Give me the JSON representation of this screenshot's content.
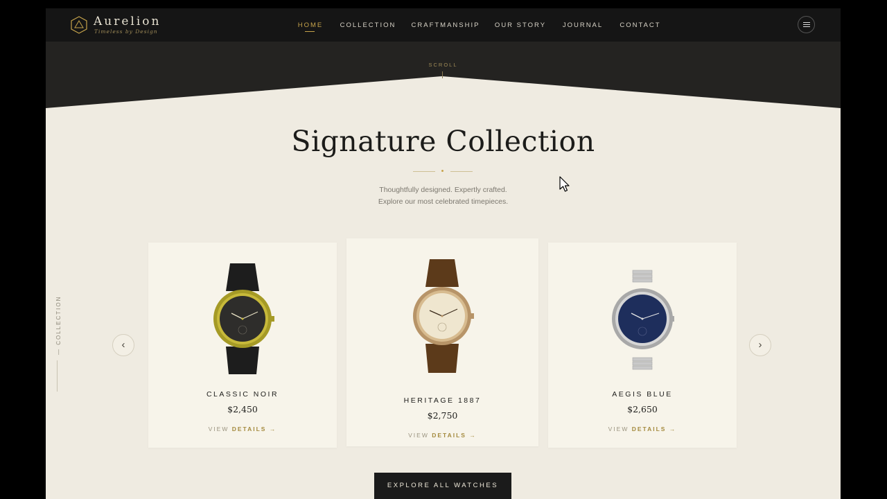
{
  "brand": {
    "name": "Aurelion",
    "tagline": "Timeless by Design"
  },
  "nav": {
    "items": [
      "HOME",
      "COLLECTION",
      "CRAFTMANSHIP",
      "OUR STORY",
      "JOURNAL",
      "CONTACT"
    ],
    "active": "HOME"
  },
  "hero": {
    "scroll_label": "SCROLL"
  },
  "section": {
    "title": "Signature Collection",
    "subtitle_line1": "Thoughtfully designed. Expertly crafted.",
    "subtitle_line2": "Explore our most celebrated timepieces.",
    "side_label": "— COLLECTION"
  },
  "carousel": {
    "prev": "‹",
    "next": "›",
    "products": [
      {
        "name": "CLASSIC NOIR",
        "price": "$2,450",
        "link_prefix": "VIEW",
        "link_emphasis": "DETAILS",
        "link_arrow": "→"
      },
      {
        "name": "HERITAGE 1887",
        "price": "$2,750",
        "link_prefix": "VIEW",
        "link_emphasis": "DETAILS",
        "link_arrow": "→"
      },
      {
        "name": "AEGIS BLUE",
        "price": "$2,650",
        "link_prefix": "VIEW",
        "link_emphasis": "DETAILS",
        "link_arrow": "→"
      }
    ]
  },
  "cta": {
    "label": "EXPLORE ALL WATCHES"
  },
  "colors": {
    "accent_gold": "#c7a44b",
    "header_bg": "#151515",
    "page_bg": "#efebe1",
    "card_bg": "#f7f4ea",
    "cta_bg": "#1b1b1b"
  }
}
